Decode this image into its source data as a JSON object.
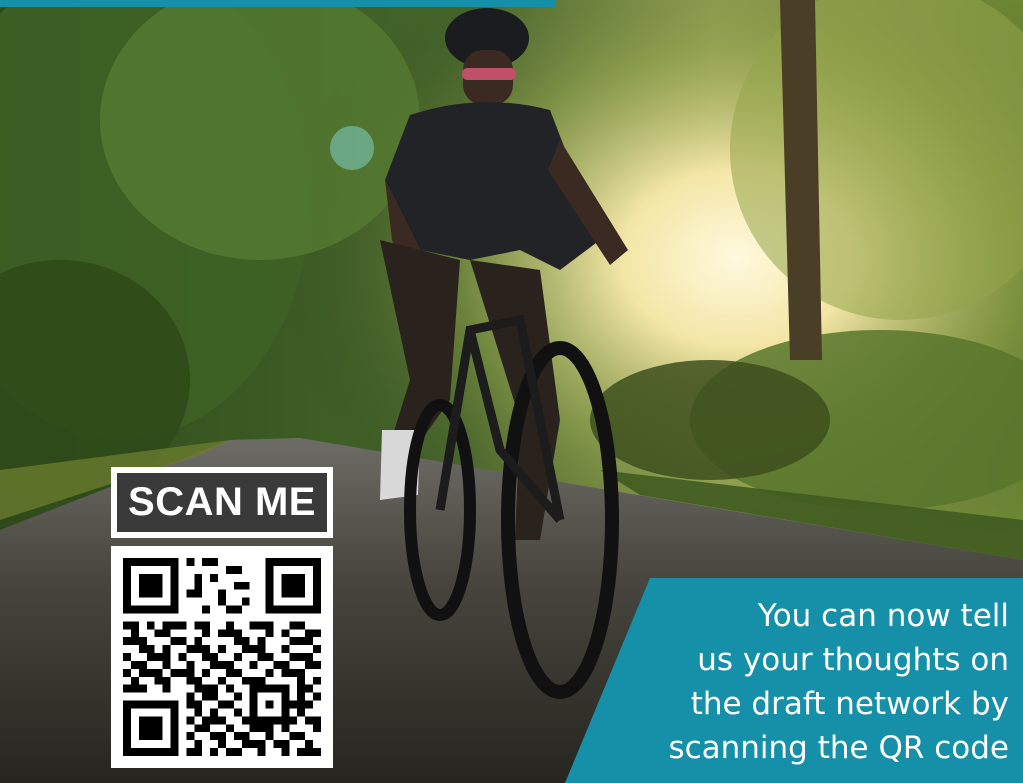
{
  "colors": {
    "accent": "#1590a8",
    "scan_label_bg": "#3a3a3a",
    "text_on_accent": "#ffffff"
  },
  "scan_label": {
    "text": "SCAN ME"
  },
  "qr_code": {
    "icon": "qr-code-icon"
  },
  "cta": {
    "lines": [
      "You can now tell",
      "us your thoughts on",
      "the draft network by",
      "scanning the QR code"
    ]
  }
}
